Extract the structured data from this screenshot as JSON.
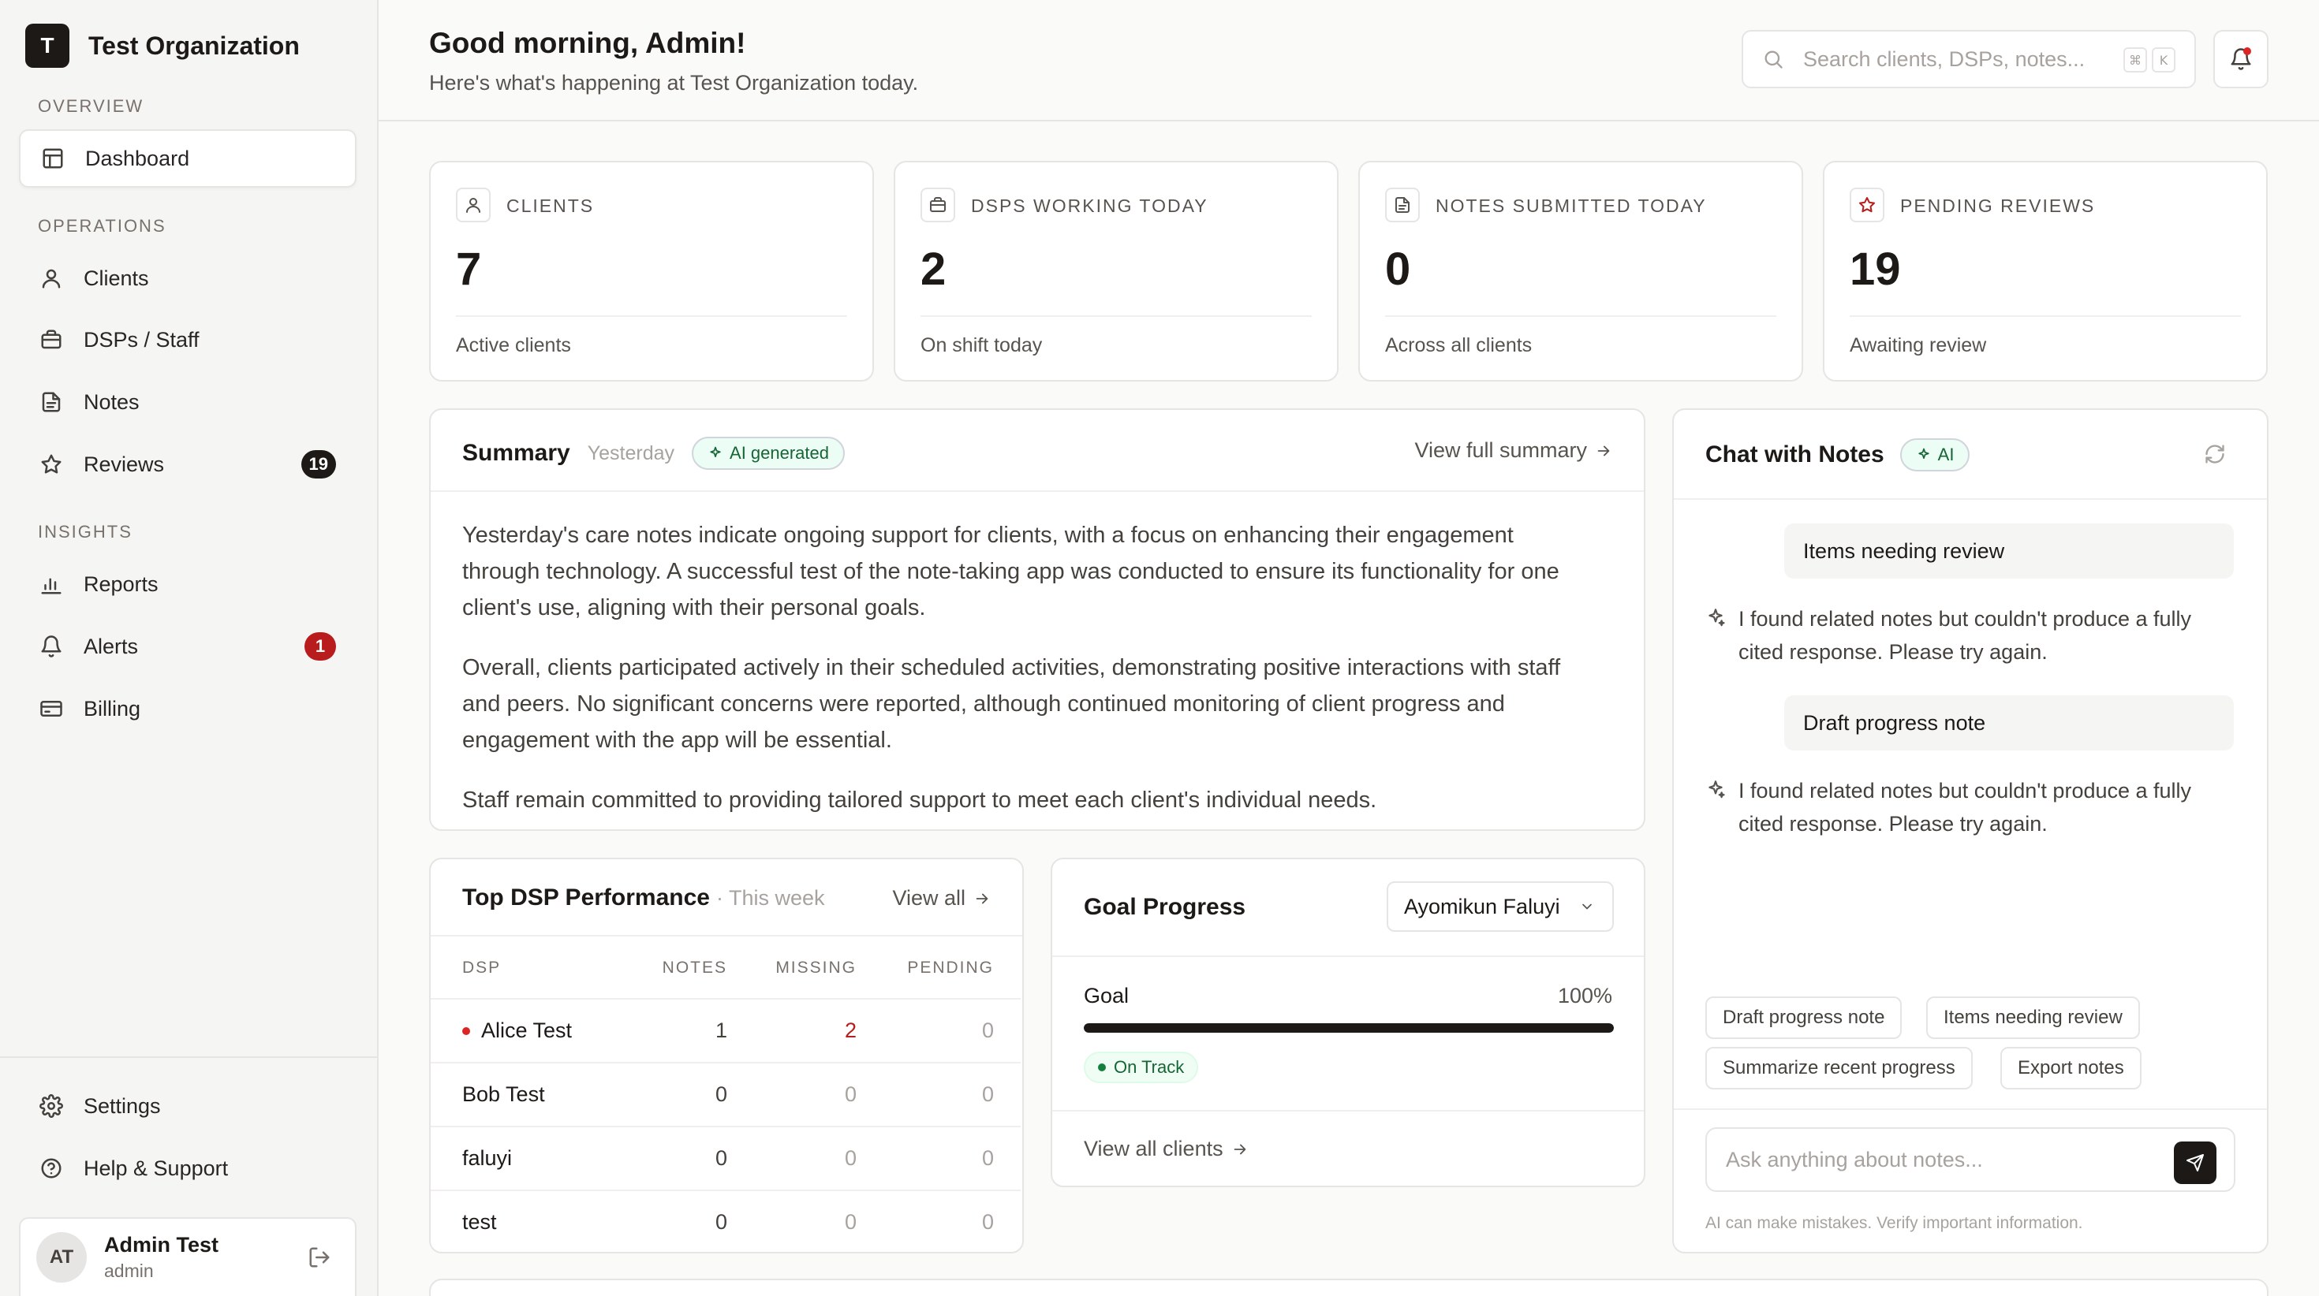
{
  "sidebar": {
    "org_initial": "T",
    "org_name": "Test Organization",
    "sections": {
      "overview": "OVERVIEW",
      "operations": "OPERATIONS",
      "insights": "INSIGHTS"
    },
    "items": {
      "dashboard": "Dashboard",
      "clients": "Clients",
      "dsps": "DSPs / Staff",
      "notes": "Notes",
      "reviews": "Reviews",
      "reviews_badge": "19",
      "reports": "Reports",
      "alerts": "Alerts",
      "alerts_badge": "1",
      "billing": "Billing",
      "settings": "Settings",
      "help": "Help & Support"
    },
    "user": {
      "initials": "AT",
      "name": "Admin Test",
      "role": "admin"
    }
  },
  "header": {
    "greeting": "Good morning, Admin!",
    "subtitle": "Here's what's happening at Test Organization today.",
    "search_placeholder": "Search clients, DSPs, notes...",
    "kbd_cmd": "⌘",
    "kbd_k": "K"
  },
  "stats": [
    {
      "label": "CLIENTS",
      "value": "7",
      "caption": "Active clients",
      "icon": "user-icon"
    },
    {
      "label": "DSPS WORKING TODAY",
      "value": "2",
      "caption": "On shift today",
      "icon": "briefcase-icon"
    },
    {
      "label": "NOTES SUBMITTED TODAY",
      "value": "0",
      "caption": "Across all clients",
      "icon": "file-icon"
    },
    {
      "label": "PENDING REVIEWS",
      "value": "19",
      "caption": "Awaiting review",
      "icon": "star-icon"
    }
  ],
  "summary": {
    "title": "Summary",
    "date": "Yesterday",
    "badge": "AI generated",
    "link": "View full summary",
    "paragraphs": [
      "Yesterday's care notes indicate ongoing support for clients, with a focus on enhancing their engagement through technology. A successful test of the note-taking app was conducted to ensure its functionality for one client's use, aligning with their personal goals.",
      "Overall, clients participated actively in their scheduled activities, demonstrating positive interactions with staff and peers. No significant concerns were reported, although continued monitoring of client progress and engagement with the app will be essential.",
      "Staff remain committed to providing tailored support to meet each client's individual needs."
    ]
  },
  "dsp_table": {
    "title": "Top DSP Performance",
    "period": "· This week",
    "link": "View all",
    "columns": [
      "DSP",
      "NOTES",
      "MISSING",
      "PENDING"
    ],
    "rows": [
      {
        "name": "Alice Test",
        "notes": "1",
        "missing": "2",
        "pending": "0",
        "flag": true
      },
      {
        "name": "Bob Test",
        "notes": "0",
        "missing": "0",
        "pending": "0",
        "flag": false
      },
      {
        "name": "faluyi",
        "notes": "0",
        "missing": "0",
        "pending": "0",
        "flag": false
      },
      {
        "name": "test",
        "notes": "0",
        "missing": "0",
        "pending": "0",
        "flag": false
      }
    ]
  },
  "goal": {
    "title": "Goal Progress",
    "selected_client": "Ayomikun Faluyi",
    "goal_label": "Goal",
    "percent": "100%",
    "progress": 1.0,
    "status": "On Track",
    "link": "View all clients"
  },
  "chat": {
    "title": "Chat with Notes",
    "badge": "AI",
    "messages": [
      {
        "role": "user",
        "text": "Items needing review"
      },
      {
        "role": "ai",
        "text": "I found related notes but couldn't produce a fully cited response. Please try again."
      },
      {
        "role": "user",
        "text": "Draft progress note"
      },
      {
        "role": "ai",
        "text": "I found related notes but couldn't produce a fully cited response. Please try again."
      }
    ],
    "suggestions": [
      "Draft progress note",
      "Items needing review",
      "Summarize recent progress",
      "Export notes"
    ],
    "input_placeholder": "Ask anything about notes...",
    "disclaimer": "AI can make mistakes. Verify important information."
  },
  "colors": {
    "accent": "#1c1917",
    "danger": "#b91c1c",
    "success": "#166534"
  }
}
